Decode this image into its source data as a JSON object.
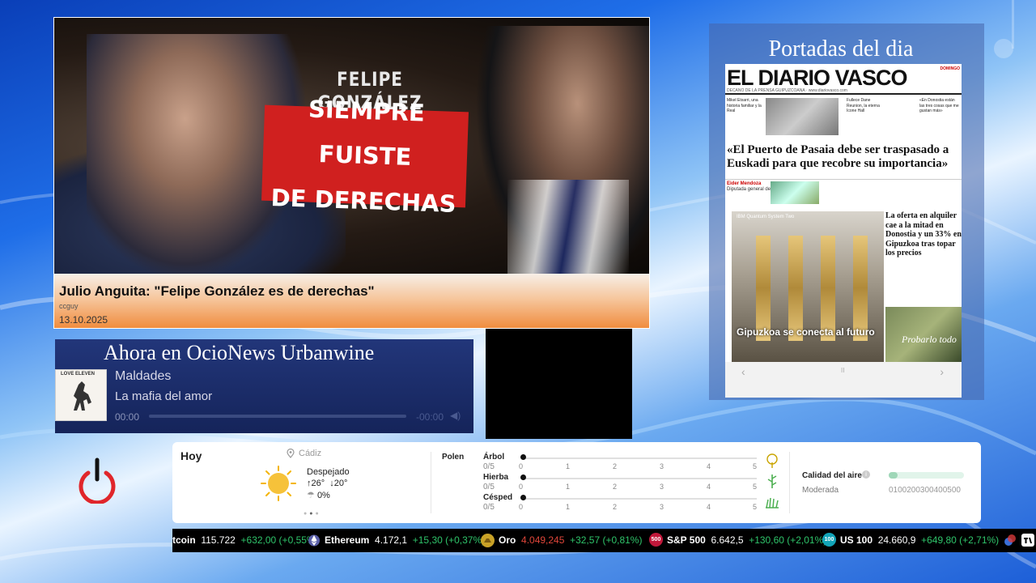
{
  "video": {
    "title": "Julio Anguita: \"Felipe González es de derechas\"",
    "channel": "ccguy",
    "date": "13.10.2025",
    "thumb_top_text": "FELIPE GONZÁLEZ",
    "thumb_banner_line1": "SIEMPRE FUISTE",
    "thumb_banner_line2": "DE DERECHAS"
  },
  "portadas": {
    "title": "Portadas del dia",
    "newspaper": {
      "name": "EL DIARIO VASCO",
      "tagline": "DECANO DE LA PRENSA GUIPUZCOANA · www.diariovasco.com",
      "side": "DOMINGO",
      "teaser1": "Mikel Etxarri, una historia familiar y la Real",
      "teaser2": "Fullece Dane Reunion, la eterna Icone Hall",
      "teaser3": "«En Donostia están las tres cosas que me gustan más»",
      "headline": "«El Puerto de Pasaia debe ser traspasado a Euskadi para que recobre su importancia»",
      "author_name": "Eider Mendoza",
      "author_role": "Diputada general de Gipuzkoa",
      "photo_caption": "IBM Quantum System Two",
      "big_caption": "Gipuzkoa se conecta al futuro",
      "side_headline": "La oferta en alquiler cae a la mitad en Donostia y un 33% en Gipuzkoa tras topar los precios",
      "ad_text": "Probarlo todo",
      "pager_prev": "‹",
      "pager_pause": "II",
      "pager_next": "›"
    }
  },
  "radio": {
    "title": "Ahora en OcioNews Urbanwine",
    "album_label": "LOVE ELEVEN",
    "song": "Maldades",
    "artist": "La mafia del amor",
    "time_current": "00:00",
    "time_end": "-00:00",
    "progress": 0
  },
  "weather": {
    "today_label": "Hoy",
    "location": "Cádiz",
    "condition": "Despejado",
    "temp_high": "26°",
    "temp_low": "20°",
    "rain": "0%",
    "polen_label": "Polen",
    "polen": [
      {
        "name": "Árbol",
        "score": "0/5",
        "value": 0
      },
      {
        "name": "Hierba",
        "score": "0/5",
        "value": 0
      },
      {
        "name": "Césped",
        "score": "0/5",
        "value": 0
      }
    ],
    "polen_ticks": [
      "0",
      "1",
      "2",
      "3",
      "4",
      "5"
    ],
    "air_quality_label": "Calidad del aire",
    "air_quality_level": "Moderada",
    "air_quality_scale": "0100200300400500",
    "air_quality_fraction": 0.12
  },
  "ticker": [
    {
      "name": "Bitcoin",
      "shown": "tcoin",
      "price": "115.722",
      "change": "+632,00 (+0,55%)"
    },
    {
      "name": "Ethereum",
      "price": "4.172,1",
      "change": "+15,30 (+0,37%)"
    },
    {
      "name": "Oro",
      "price": "4.049,245",
      "change": "+32,57 (+0,81%)"
    },
    {
      "name": "S&P 500",
      "badge": "500",
      "price": "6.642,5",
      "change": "+130,60 (+2,01%)"
    },
    {
      "name": "US 100",
      "badge": "100",
      "price": "24.660,9",
      "change": "+649,80 (+2,71%)"
    }
  ],
  "colors": {
    "accent_red": "#d0201f",
    "power_red": "#e0262b",
    "ticker_up": "#2fc46a",
    "radio_bg": "#22367a"
  }
}
